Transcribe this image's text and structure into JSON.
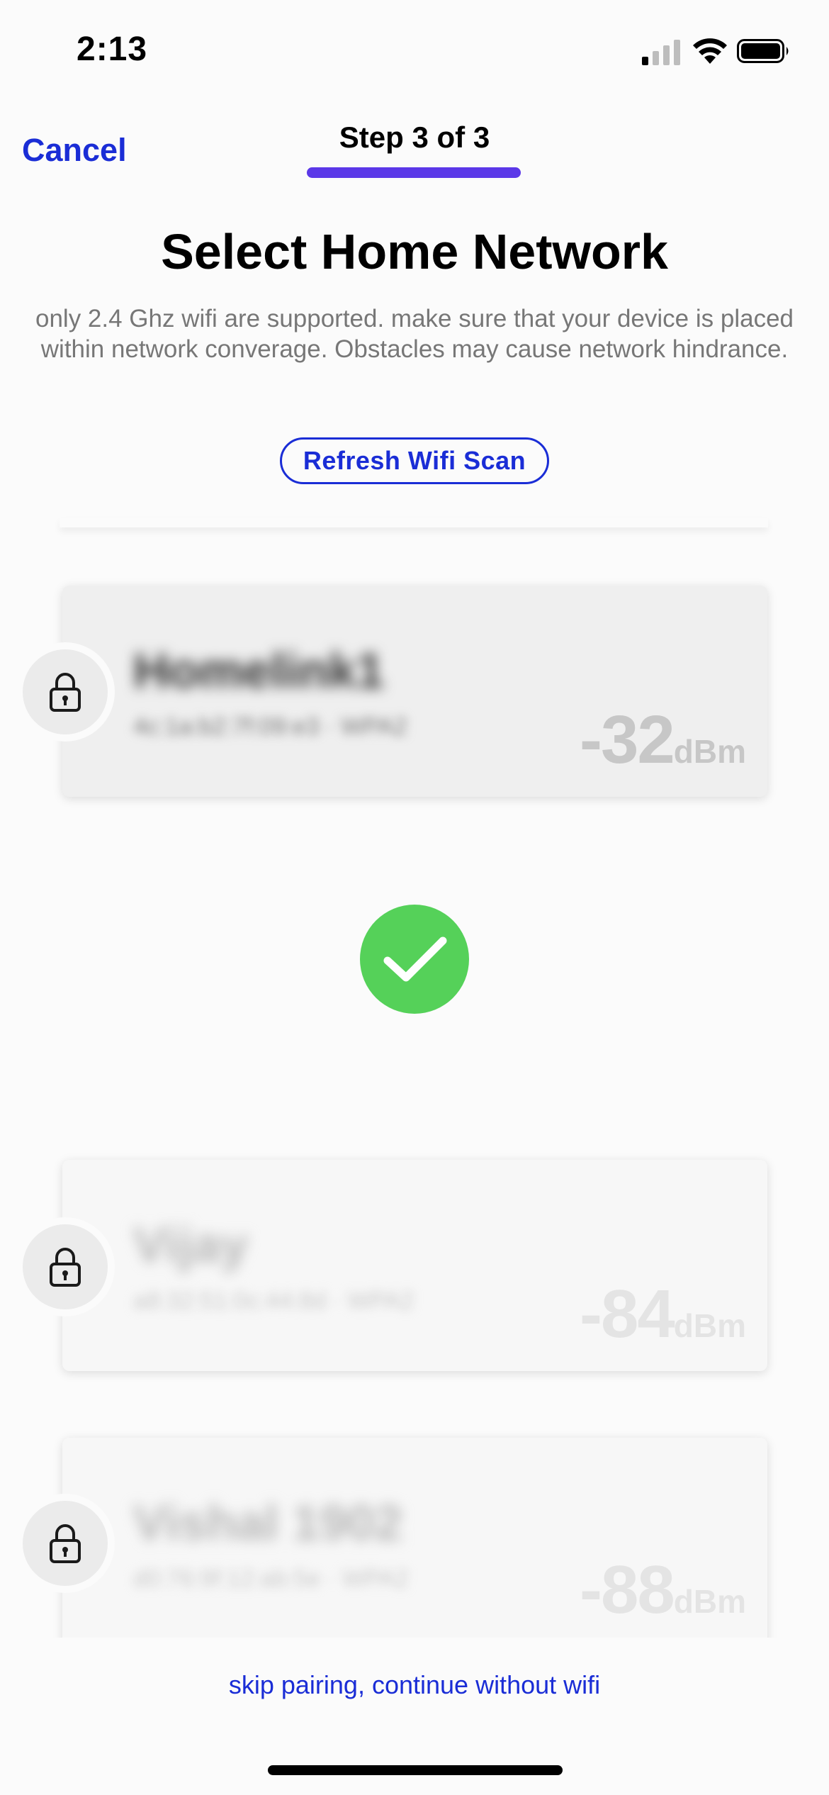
{
  "status_bar": {
    "time": "2:13"
  },
  "header": {
    "cancel_label": "Cancel",
    "step_label": "Step 3 of 3",
    "title": "Select Home Network",
    "subtitle": "only 2.4 Ghz wifi are supported. make sure that your device is placed within network converage. Obstacles may cause network hindrance.",
    "refresh_label": "Refresh Wifi Scan"
  },
  "networks": [
    {
      "name": "Homelink1",
      "detail": "4c:1a:b2:7f:09:e3 · WPA2",
      "signal_value": "-32",
      "signal_unit": "dBm",
      "selected": true,
      "icon": "lock-icon"
    },
    {
      "name": "Vijay",
      "detail": "a8:32:51:0c:44:8d · WPA2",
      "signal_value": "-84",
      "signal_unit": "dBm",
      "selected": false,
      "icon": "lock-icon"
    },
    {
      "name": "Vishal 1902",
      "detail": "d0:76:9f:12:ab:5e · WPA2",
      "signal_value": "-88",
      "signal_unit": "dBm",
      "selected": false,
      "icon": "lock-icon"
    }
  ],
  "selection_icon": "checkmark-icon",
  "footer": {
    "skip_label": "skip pairing, continue without wifi"
  },
  "colors": {
    "accent": "#1a2dd6",
    "step_bar": "#5b38e8",
    "success": "#55d159"
  }
}
